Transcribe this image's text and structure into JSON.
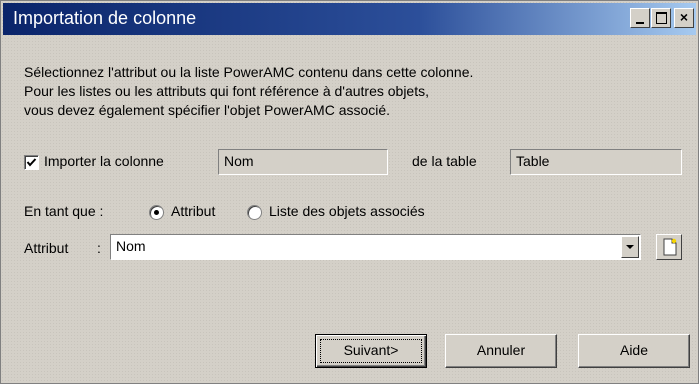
{
  "window": {
    "title": "Importation de colonne",
    "title_bar_color": "#0a246a",
    "controls": [
      "minimize-icon",
      "maximize-icon",
      "close-icon"
    ]
  },
  "instructions": [
    "Sélectionnez l'attribut ou la liste PowerAMC contenu dans cette colonne.",
    "Pour les listes ou les attributs qui font référence à d'autres objets,",
    "vous devez également spécifier l'objet PowerAMC associé."
  ],
  "import": {
    "checkbox_checked": true,
    "label": "Importer la colonne",
    "column_value": "Nom",
    "table_label": "de la table",
    "table_value": "Table"
  },
  "as": {
    "label": "En tant que :",
    "options": [
      {
        "label": "Attribut",
        "selected": true
      },
      {
        "label": "Liste des objets associés",
        "selected": false
      }
    ]
  },
  "attribute": {
    "label": "Attribut",
    "separator": ":",
    "selected_value": "Nom",
    "new_button_icon": "new-document-icon"
  },
  "buttons": {
    "next": "Suivant>",
    "cancel": "Annuler",
    "help": "Aide"
  }
}
